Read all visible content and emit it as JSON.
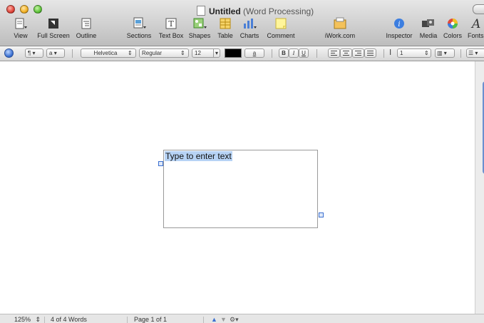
{
  "window": {
    "title": "Untitled",
    "subtitle": "(Word Processing)"
  },
  "toolbar": {
    "items": [
      {
        "label": "View",
        "icon": "view-icon"
      },
      {
        "label": "Full Screen",
        "icon": "full-screen-icon"
      },
      {
        "label": "Outline",
        "icon": "outline-icon"
      },
      {
        "label": "Sections",
        "icon": "sections-icon"
      },
      {
        "label": "Text Box",
        "icon": "text-box-icon"
      },
      {
        "label": "Shapes",
        "icon": "shapes-icon"
      },
      {
        "label": "Table",
        "icon": "table-icon"
      },
      {
        "label": "Charts",
        "icon": "charts-icon"
      },
      {
        "label": "Comment",
        "icon": "comment-icon"
      },
      {
        "label": "iWork.com",
        "icon": "iwork-share-icon"
      },
      {
        "label": "Inspector",
        "icon": "inspector-icon"
      },
      {
        "label": "Media",
        "icon": "media-icon"
      },
      {
        "label": "Colors",
        "icon": "colors-icon"
      },
      {
        "label": "Fonts",
        "icon": "fonts-icon"
      }
    ]
  },
  "format_bar": {
    "paragraph_style": "¶",
    "char_style": "a",
    "font_family": "Helvetica",
    "font_style": "Regular",
    "font_size": "12",
    "text_color": "#000000",
    "background_color_glyph": "a",
    "bold": "B",
    "italic": "I",
    "underline": "U",
    "line_spacing": "1",
    "accent": "#3a6fd1"
  },
  "document": {
    "placeholder_text": "Type to enter text"
  },
  "status": {
    "zoom": "125%",
    "word_count": "4 of 4 Words",
    "page": "Page 1 of 1"
  }
}
